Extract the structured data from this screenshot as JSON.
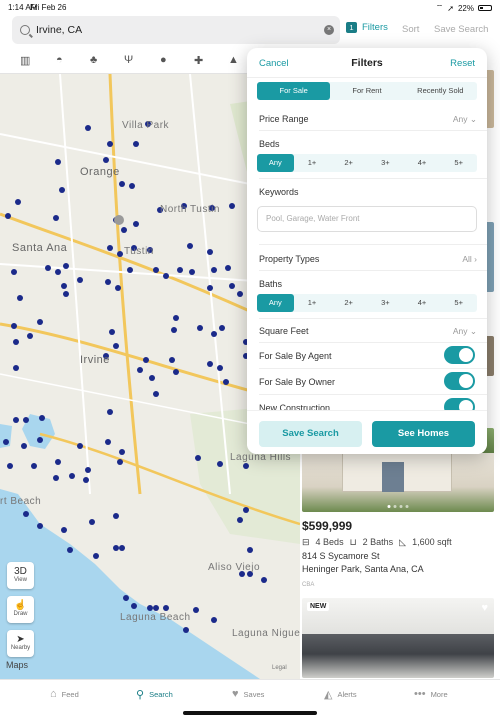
{
  "status": {
    "time": "1:14 AM",
    "date": "Fri Feb 26",
    "battery": "22%"
  },
  "topbar": {
    "search_value": "Irvine, CA",
    "filters_count": "1",
    "filters_label": "Filters",
    "sort_label": "Sort",
    "save_search_label": "Save Search"
  },
  "categories": [
    "map-icon",
    "school-icon",
    "park-icon",
    "restaurant-icon",
    "person-icon",
    "hospital-icon",
    "warning-icon"
  ],
  "map": {
    "labels": {
      "villa_park": "Villa Park",
      "orange": "Orange",
      "north_tustin": "North Tustin",
      "santa_ana": "Santa Ana",
      "tustin": "Tustin",
      "irvine": "Irvine",
      "laguna_hills": "Laguna Hills",
      "beach": "rt Beach",
      "aliso_viejo": "Aliso Viejo",
      "laguna_beach": "Laguna Beach",
      "laguna_niguel": "Laguna Niguel"
    },
    "controls": {
      "view_top": "3D",
      "view_bottom": "View",
      "draw": "Draw",
      "nearby": "Nearby"
    },
    "attribution": "Maps",
    "legal": "Legal",
    "marker_color": "#1b2a8a"
  },
  "filter_sheet": {
    "cancel": "Cancel",
    "title": "Filters",
    "reset": "Reset",
    "listing_types": [
      "For Sale",
      "For Rent",
      "Recently Sold"
    ],
    "listing_type_selected": "For Sale",
    "price_range_label": "Price Range",
    "price_range_value": "Any",
    "beds_label": "Beds",
    "beds_options": [
      "Any",
      "1+",
      "2+",
      "3+",
      "4+",
      "5+"
    ],
    "keywords_label": "Keywords",
    "keywords_placeholder": "Pool, Garage, Water Front",
    "property_types_label": "Property Types",
    "property_types_value": "All",
    "baths_label": "Baths",
    "baths_options": [
      "Any",
      "1+",
      "2+",
      "3+",
      "4+",
      "5+"
    ],
    "square_feet_label": "Square Feet",
    "square_feet_value": "Any",
    "for_sale_by_agent": "For Sale By Agent",
    "for_sale_by_owner": "For Sale By Owner",
    "new_construction": "New Construction",
    "save_search_button": "Save Search",
    "see_homes_button": "See Homes",
    "accent": "#1a9aa3"
  },
  "listings": [
    {
      "price": "$599,999",
      "beds": "4 Beds",
      "baths": "2 Baths",
      "sqft": "1,600 sqft",
      "address1": "814 S Sycamore St",
      "address2": "Heninger Park, Santa Ana, CA",
      "brokerage": "CBA"
    },
    {
      "badge": "NEW"
    }
  ],
  "tabbar": {
    "feed": "Feed",
    "search": "Search",
    "saves": "Saves",
    "alerts": "Alerts",
    "more": "More"
  }
}
